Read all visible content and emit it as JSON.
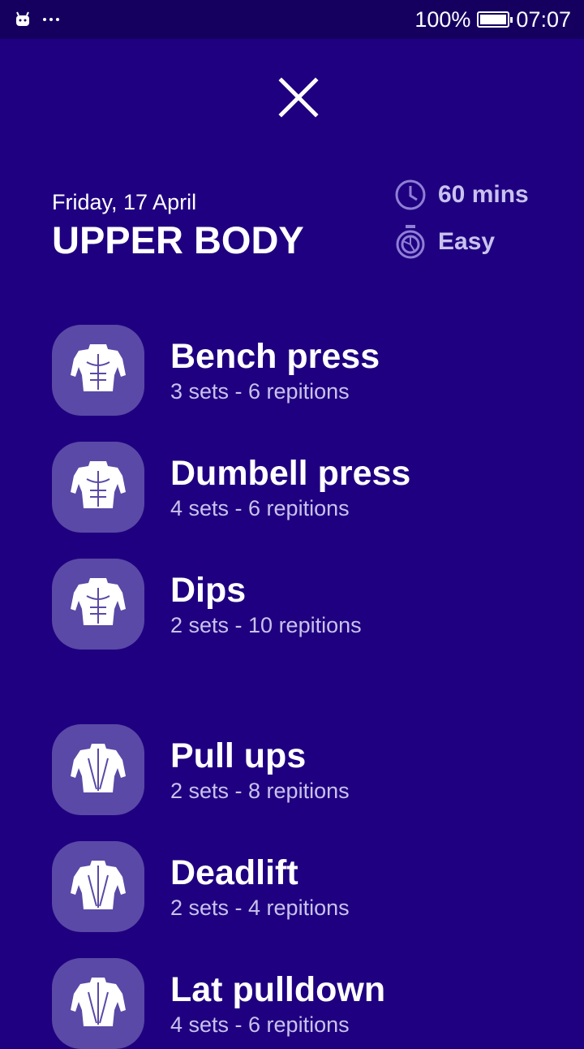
{
  "status_bar": {
    "battery_percent": "100%",
    "battery_level": 1.0,
    "time": "07:07",
    "app_icon": "android-icon",
    "overflow_icon": "more-dots-icon"
  },
  "header": {
    "close_icon": "close-icon",
    "date": "Friday, 17 April",
    "title": "UPPER BODY",
    "duration": "60 mins",
    "duration_icon": "clock-icon",
    "difficulty": "Easy",
    "difficulty_icon": "stopwatch-icon"
  },
  "exercises": [
    {
      "name": "Bench press",
      "detail": "3 sets - 6 repitions",
      "icon": "chest-muscle-icon"
    },
    {
      "name": "Dumbell press",
      "detail": "4 sets - 6 repitions",
      "icon": "chest-muscle-icon"
    },
    {
      "name": "Dips",
      "detail": "2 sets - 10 repitions",
      "icon": "chest-muscle-icon"
    },
    {
      "name": "Pull ups",
      "detail": "2 sets - 8 repitions",
      "icon": "back-muscle-icon"
    },
    {
      "name": "Deadlift",
      "detail": "2 sets - 4 repitions",
      "icon": "back-muscle-icon"
    },
    {
      "name": "Lat pulldown",
      "detail": "4 sets - 6 repitions",
      "icon": "back-muscle-icon"
    }
  ],
  "colors": {
    "background": "#1f0080",
    "status_bar": "#150060",
    "thumb": "#5a49a6",
    "muted_text": "#c9c2ee"
  }
}
